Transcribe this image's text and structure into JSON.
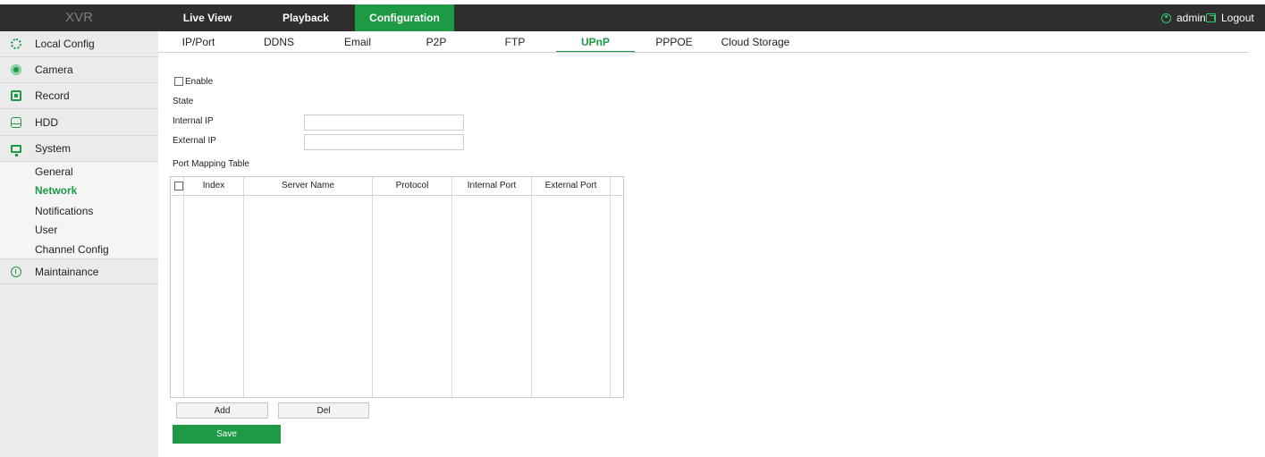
{
  "brand": "XVR",
  "topnav": {
    "items": [
      {
        "label": "Live View"
      },
      {
        "label": "Playback"
      },
      {
        "label": "Configuration"
      }
    ],
    "user": "admin",
    "logout": "Logout"
  },
  "sidebar": {
    "items": [
      {
        "label": "Local Config",
        "icon": "gear-icon"
      },
      {
        "label": "Camera",
        "icon": "camera-icon"
      },
      {
        "label": "Record",
        "icon": "record-icon"
      },
      {
        "label": "HDD",
        "icon": "hdd-icon"
      },
      {
        "label": "System",
        "icon": "monitor-icon"
      },
      {
        "label": "Maintainance",
        "icon": "info-icon"
      }
    ],
    "subitems": [
      {
        "label": "General"
      },
      {
        "label": "Network"
      },
      {
        "label": "Notifications"
      },
      {
        "label": "User"
      },
      {
        "label": "Channel Config"
      }
    ]
  },
  "tabs": [
    {
      "label": "IP/Port"
    },
    {
      "label": "DDNS"
    },
    {
      "label": "Email"
    },
    {
      "label": "P2P"
    },
    {
      "label": "FTP"
    },
    {
      "label": "UPnP"
    },
    {
      "label": "PPPOE"
    },
    {
      "label": "Cloud Storage"
    }
  ],
  "form": {
    "enable_label": "Enable",
    "enable_checked": false,
    "state_label": "State",
    "internal_ip_label": "Internal IP",
    "internal_ip_value": "",
    "external_ip_label": "External IP",
    "external_ip_value": "",
    "port_mapping_label": "Port Mapping Table"
  },
  "table": {
    "columns": [
      "Index",
      "Server Name",
      "Protocol",
      "Internal Port",
      "External Port"
    ],
    "rows": []
  },
  "buttons": {
    "add": "Add",
    "del": "Del",
    "save": "Save"
  },
  "colors": {
    "accent": "#1e9a45",
    "topbar": "#2e2e2e",
    "sidebar": "#ebebeb"
  }
}
